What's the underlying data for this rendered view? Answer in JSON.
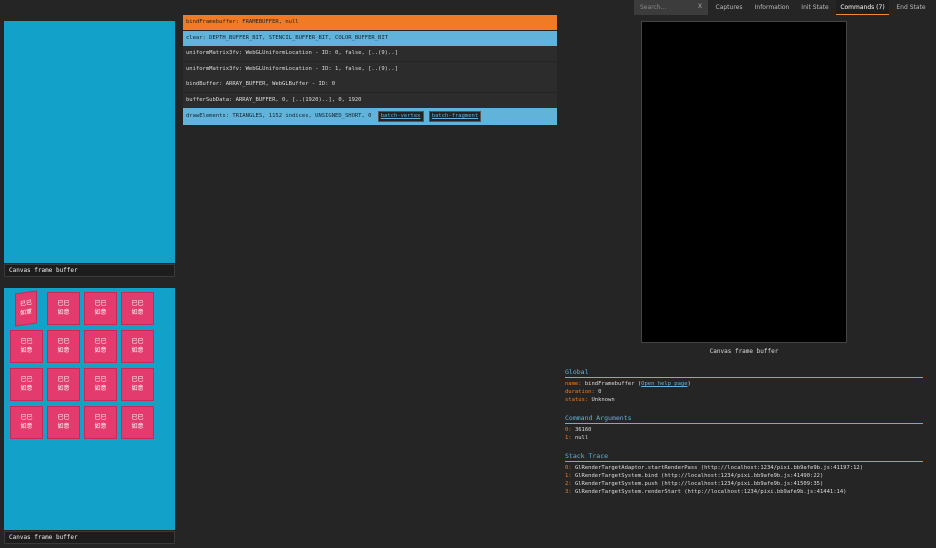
{
  "topbar": {
    "search_placeholder": "Search...",
    "search_clear": "X",
    "tabs": [
      "Captures",
      "Information",
      "Init State",
      "Commands (7)",
      "End State"
    ]
  },
  "left": {
    "thumb_label_1": "Canvas frame buffer",
    "thumb_label_2": "Canvas frame buffer",
    "tile_text": "已已\n如意",
    "tile_text_tilted": "已已\n如意",
    "thumb_color": "#11a1c9",
    "tile_color": "#e33b6e"
  },
  "commands": [
    {
      "text": "bindFramebuffer: FRAMEBUFFER, null"
    },
    {
      "text": "clear: DEPTH_BUFFER_BIT, STENCIL_BUFFER_BIT, COLOR_BUFFER_BIT"
    },
    {
      "text": "uniformMatrix3fv: WebGLUniformLocation - ID: 0, false, [..(9)..]"
    },
    {
      "text": "uniformMatrix3fv: WebGLUniformLocation - ID: 1, false, [..(9)..]"
    },
    {
      "text": "bindBuffer: ARRAY_BUFFER, WebGLBuffer - ID: 0"
    },
    {
      "text": "bufferSubData: ARRAY_BUFFER, 0, [..(1920)..], 0, 1920"
    },
    {
      "text": "drawElements: TRIANGLES, 1152 indices, UNSIGNED_SHORT, 0",
      "links": [
        "batch-vertex",
        "batch-fragment"
      ]
    }
  ],
  "preview": {
    "label": "Canvas frame buffer"
  },
  "global": {
    "title": "Global",
    "name_key": "name:",
    "name_value": "bindFramebuffer",
    "help_link": "Open help page",
    "duration_key": "duration:",
    "duration_value": "0",
    "status_key": "status:",
    "status_value": "Unknown"
  },
  "arguments": {
    "title": "Command Arguments",
    "items": [
      {
        "key": "0:",
        "value": "36160"
      },
      {
        "key": "1:",
        "value": "null"
      }
    ]
  },
  "stack": {
    "title": "Stack Trace",
    "items": [
      {
        "key": "0:",
        "value": "GlRenderTargetAdaptor.startRenderPass (http://localhost:1234/pixi.bb9afe9b.js:41197:12)"
      },
      {
        "key": "1:",
        "value": "GlRenderTargetSystem.bind (http://localhost:1234/pixi.bb9afe9b.js:41490:22)"
      },
      {
        "key": "2:",
        "value": "GlRenderTargetSystem.push (http://localhost:1234/pixi.bb9afe9b.js:41509:35)"
      },
      {
        "key": "3:",
        "value": "GlRenderTargetSystem.renderStart (http://localhost:1234/pixi.bb9afe9b.js:41441:14)"
      }
    ]
  }
}
